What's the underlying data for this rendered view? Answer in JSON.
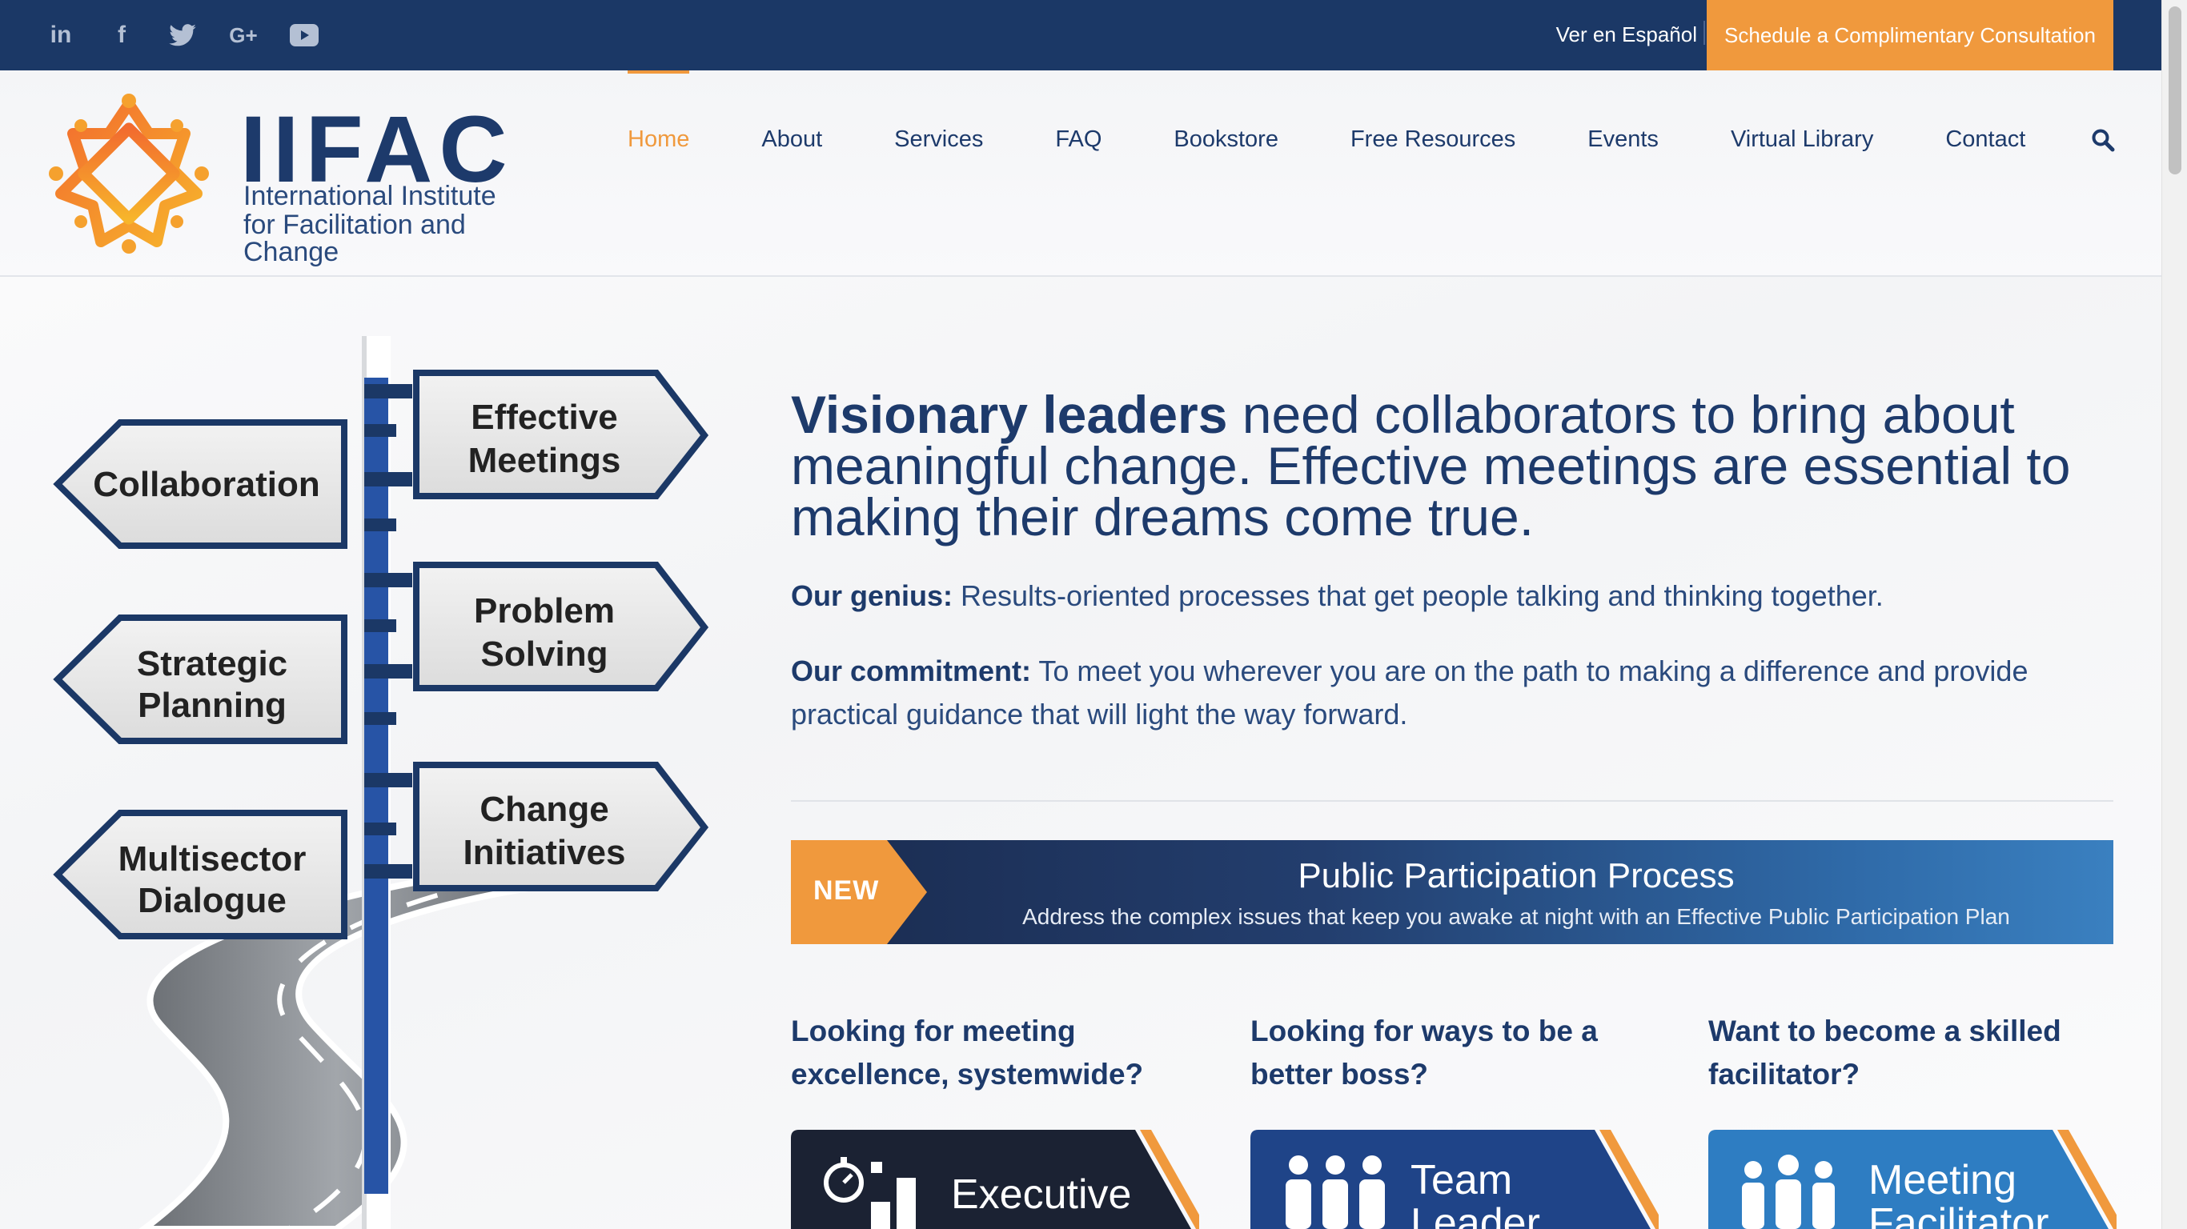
{
  "topbar": {
    "social": [
      {
        "name": "linkedin",
        "glyph": "in"
      },
      {
        "name": "facebook",
        "glyph": "f"
      },
      {
        "name": "twitter",
        "glyph": "t"
      },
      {
        "name": "google-plus",
        "glyph": "G+"
      },
      {
        "name": "youtube",
        "glyph": "▶"
      }
    ],
    "language_link": "Ver en Español",
    "cta": "Schedule a Complimentary Consultation"
  },
  "logo": {
    "word": "IIFAC",
    "line1": "International Institute",
    "line2": "for Facilitation and Change"
  },
  "nav": {
    "items": [
      {
        "label": "Home",
        "active": true
      },
      {
        "label": "About"
      },
      {
        "label": "Services"
      },
      {
        "label": "FAQ"
      },
      {
        "label": "Bookstore"
      },
      {
        "label": "Free Resources"
      },
      {
        "label": "Events"
      },
      {
        "label": "Virtual Library"
      },
      {
        "label": "Contact"
      }
    ],
    "search_icon": "search-icon"
  },
  "hero_art": {
    "signs_left": [
      "Collaboration",
      "Strategic|Planning",
      "Multisector|Dialogue"
    ],
    "signs_right": [
      "Effective|Meetings",
      "Problem|Solving",
      "Change|Initiatives"
    ]
  },
  "main": {
    "headline_strong": "Visionary leaders",
    "headline_rest": " need collaborators to bring about meaningful change. Effective meetings are essential to making their dreams come true.",
    "genius_label": "Our genius:",
    "genius_text": " Results-oriented processes that get people talking and thinking together.",
    "commitment_label": "Our commitment:",
    "commitment_text": " To meet you wherever you are on the path to making a difference and provide practical guidance that will light the way forward."
  },
  "banner": {
    "badge": "NEW",
    "title": "Public Participation Process",
    "subtitle": "Address the complex issues that keep you awake at night with an Effective Public Participation Plan"
  },
  "columns": [
    {
      "question": "Looking for meeting excellence, systemwide?",
      "card": "Executive"
    },
    {
      "question": "Looking for ways to be a better boss?",
      "card": "Team Leader"
    },
    {
      "question": "Want to become a skilled facilitator?",
      "card": "Meeting Facilitator"
    }
  ],
  "colors": {
    "navy": "#1b3866",
    "orange": "#f0993d",
    "text": "#1d3a6b"
  }
}
